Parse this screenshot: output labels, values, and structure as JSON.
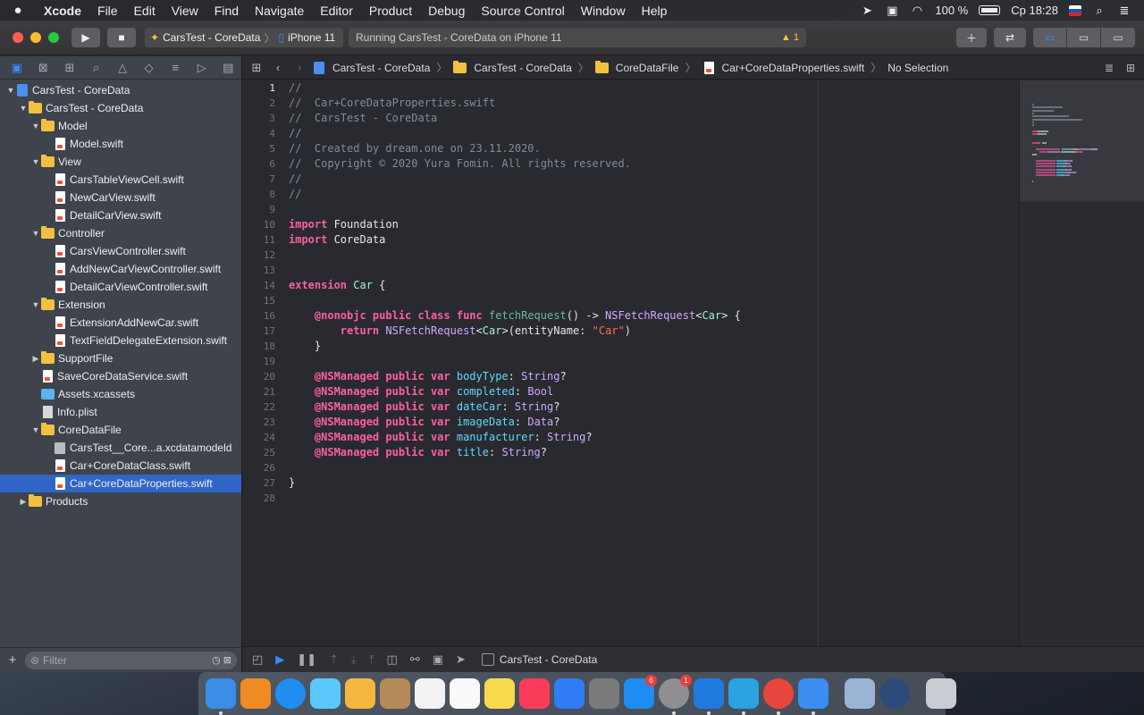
{
  "menubar": {
    "app": "Xcode",
    "items": [
      "File",
      "Edit",
      "View",
      "Find",
      "Navigate",
      "Editor",
      "Product",
      "Debug",
      "Source Control",
      "Window",
      "Help"
    ],
    "battery": "100 %",
    "clock": "Ср 18:28"
  },
  "toolbar": {
    "scheme_project": "CarsTest - CoreData",
    "scheme_device": "iPhone 11",
    "status_text": "Running CarsTest - CoreData on iPhone 11",
    "warning_count": "1"
  },
  "navigator": {
    "filter_placeholder": "Filter",
    "tree": [
      {
        "label": "CarsTest - CoreData",
        "kind": "proj",
        "indent": 0,
        "disc": "open"
      },
      {
        "label": "CarsTest - CoreData",
        "kind": "folder",
        "indent": 1,
        "disc": "open"
      },
      {
        "label": "Model",
        "kind": "folder",
        "indent": 2,
        "disc": "open"
      },
      {
        "label": "Model.swift",
        "kind": "swift",
        "indent": 3,
        "disc": ""
      },
      {
        "label": "View",
        "kind": "folder",
        "indent": 2,
        "disc": "open"
      },
      {
        "label": "CarsTableViewCell.swift",
        "kind": "swift",
        "indent": 3,
        "disc": ""
      },
      {
        "label": "NewCarView.swift",
        "kind": "swift",
        "indent": 3,
        "disc": ""
      },
      {
        "label": "DetailCarView.swift",
        "kind": "swift",
        "indent": 3,
        "disc": ""
      },
      {
        "label": "Controller",
        "kind": "folder",
        "indent": 2,
        "disc": "open"
      },
      {
        "label": "CarsViewController.swift",
        "kind": "swift",
        "indent": 3,
        "disc": ""
      },
      {
        "label": "AddNewCarViewController.swift",
        "kind": "swift",
        "indent": 3,
        "disc": ""
      },
      {
        "label": "DetailCarViewController.swift",
        "kind": "swift",
        "indent": 3,
        "disc": ""
      },
      {
        "label": "Extension",
        "kind": "folder",
        "indent": 2,
        "disc": "open"
      },
      {
        "label": "ExtensionAddNewCar.swift",
        "kind": "swift",
        "indent": 3,
        "disc": ""
      },
      {
        "label": "TextFieldDelegateExtension.swift",
        "kind": "swift",
        "indent": 3,
        "disc": ""
      },
      {
        "label": "SupportFile",
        "kind": "folder",
        "indent": 2,
        "disc": "closed"
      },
      {
        "label": "SaveCoreDataService.swift",
        "kind": "swift",
        "indent": 2,
        "disc": ""
      },
      {
        "label": "Assets.xcassets",
        "kind": "xcassets",
        "indent": 2,
        "disc": ""
      },
      {
        "label": "Info.plist",
        "kind": "plist",
        "indent": 2,
        "disc": ""
      },
      {
        "label": "CoreDataFile",
        "kind": "folder",
        "indent": 2,
        "disc": "open"
      },
      {
        "label": "CarsTest__Core...a.xcdatamodeld",
        "kind": "model",
        "indent": 3,
        "disc": ""
      },
      {
        "label": "Car+CoreDataClass.swift",
        "kind": "swift",
        "indent": 3,
        "disc": ""
      },
      {
        "label": "Car+CoreDataProperties.swift",
        "kind": "swift",
        "indent": 3,
        "disc": "",
        "selected": true
      },
      {
        "label": "Products",
        "kind": "folder",
        "indent": 1,
        "disc": "closed"
      }
    ]
  },
  "jumpbar": {
    "crumbs": [
      "CarsTest - CoreData",
      "CarsTest - CoreData",
      "CoreDataFile",
      "Car+CoreDataProperties.swift",
      "No Selection"
    ]
  },
  "editor": {
    "current_line": 1,
    "lines": [
      [
        [
          "com",
          "//"
        ]
      ],
      [
        [
          "com",
          "//  Car+CoreDataProperties.swift"
        ]
      ],
      [
        [
          "com",
          "//  CarsTest - CoreData"
        ]
      ],
      [
        [
          "com",
          "//"
        ]
      ],
      [
        [
          "com",
          "//  Created by dream.one on 23.11.2020."
        ]
      ],
      [
        [
          "com",
          "//  Copyright © 2020 Yura Fomin. All rights reserved."
        ]
      ],
      [
        [
          "com",
          "//"
        ]
      ],
      [
        [
          "com",
          "//"
        ]
      ],
      [],
      [
        [
          "kw",
          "import"
        ],
        [
          "",
          " Foundation"
        ]
      ],
      [
        [
          "kw",
          "import"
        ],
        [
          "",
          " CoreData"
        ]
      ],
      [],
      [],
      [
        [
          "kw",
          "extension"
        ],
        [
          "",
          " "
        ],
        [
          "tyc",
          "Car"
        ],
        [
          "",
          " {"
        ]
      ],
      [],
      [
        [
          "",
          "    "
        ],
        [
          "kw",
          "@nonobjc public class func"
        ],
        [
          "",
          " "
        ],
        [
          "fn",
          "fetchRequest"
        ],
        [
          "",
          "() -> "
        ],
        [
          "ty",
          "NSFetchRequest"
        ],
        [
          "",
          "<"
        ],
        [
          "tyc",
          "Car"
        ],
        [
          "",
          "> {"
        ]
      ],
      [
        [
          "",
          "        "
        ],
        [
          "kw",
          "return"
        ],
        [
          "",
          " "
        ],
        [
          "ty",
          "NSFetchRequest"
        ],
        [
          "",
          "<"
        ],
        [
          "tyc",
          "Car"
        ],
        [
          "",
          ">(entityName: "
        ],
        [
          "str",
          "\"Car\""
        ],
        [
          "",
          ")"
        ]
      ],
      [
        [
          "",
          "    }"
        ]
      ],
      [],
      [
        [
          "",
          "    "
        ],
        [
          "kw",
          "@NSManaged public var"
        ],
        [
          "",
          " "
        ],
        [
          "prop",
          "bodyType"
        ],
        [
          "",
          ": "
        ],
        [
          "ty",
          "String"
        ],
        [
          "",
          "?"
        ]
      ],
      [
        [
          "",
          "    "
        ],
        [
          "kw",
          "@NSManaged public var"
        ],
        [
          "",
          " "
        ],
        [
          "prop",
          "completed"
        ],
        [
          "",
          ": "
        ],
        [
          "ty",
          "Bool"
        ]
      ],
      [
        [
          "",
          "    "
        ],
        [
          "kw",
          "@NSManaged public var"
        ],
        [
          "",
          " "
        ],
        [
          "prop",
          "dateCar"
        ],
        [
          "",
          ": "
        ],
        [
          "ty",
          "String"
        ],
        [
          "",
          "?"
        ]
      ],
      [
        [
          "",
          "    "
        ],
        [
          "kw",
          "@NSManaged public var"
        ],
        [
          "",
          " "
        ],
        [
          "prop",
          "imageData"
        ],
        [
          "",
          ": "
        ],
        [
          "ty",
          "Data"
        ],
        [
          "",
          "?"
        ]
      ],
      [
        [
          "",
          "    "
        ],
        [
          "kw",
          "@NSManaged public var"
        ],
        [
          "",
          " "
        ],
        [
          "prop",
          "manufacturer"
        ],
        [
          "",
          ": "
        ],
        [
          "ty",
          "String"
        ],
        [
          "",
          "?"
        ]
      ],
      [
        [
          "",
          "    "
        ],
        [
          "kw",
          "@NSManaged public var"
        ],
        [
          "",
          " "
        ],
        [
          "prop",
          "title"
        ],
        [
          "",
          ": "
        ],
        [
          "ty",
          "String"
        ],
        [
          "",
          "?"
        ]
      ],
      [],
      [
        [
          "",
          "}"
        ]
      ],
      []
    ]
  },
  "debugbar": {
    "target": "CarsTest - CoreData"
  },
  "dock": {
    "apps": [
      {
        "name": "finder",
        "color": "#3a8ee6",
        "running": true
      },
      {
        "name": "books",
        "color": "#f08a24",
        "running": false
      },
      {
        "name": "safari",
        "color": "#1f8ef0",
        "running": false
      },
      {
        "name": "messages",
        "color": "#5ac8fa",
        "running": false
      },
      {
        "name": "photos",
        "color": "#f4b63f",
        "running": false
      },
      {
        "name": "contacts",
        "color": "#b58a5b",
        "running": false
      },
      {
        "name": "calendar",
        "color": "#f2f2f2",
        "running": false
      },
      {
        "name": "reminders",
        "color": "#fafafa",
        "running": false
      },
      {
        "name": "notes",
        "color": "#f7d94c",
        "running": false
      },
      {
        "name": "music",
        "color": "#fa3c5a",
        "running": false
      },
      {
        "name": "keynote",
        "color": "#2f7cf6",
        "running": false
      },
      {
        "name": "calculator",
        "color": "#7a7a7a",
        "running": false
      },
      {
        "name": "app-store",
        "color": "#1e8cf5",
        "running": false,
        "badge": "6"
      },
      {
        "name": "system-preferences",
        "color": "#8e8e93",
        "running": true,
        "badge": "1"
      },
      {
        "name": "xcode",
        "color": "#1f7ae0",
        "running": true
      },
      {
        "name": "telegram",
        "color": "#2aa3e0",
        "running": true
      },
      {
        "name": "chrome",
        "color": "#e8453c",
        "running": true
      },
      {
        "name": "simulator",
        "color": "#3a8ef0",
        "running": true
      },
      {
        "name": "preview",
        "color": "#9bb4d6",
        "running": false
      },
      {
        "name": "quicktime",
        "color": "#2c4b7a",
        "running": false
      },
      {
        "name": "trash",
        "color": "#c9ccd2",
        "running": false
      }
    ]
  }
}
